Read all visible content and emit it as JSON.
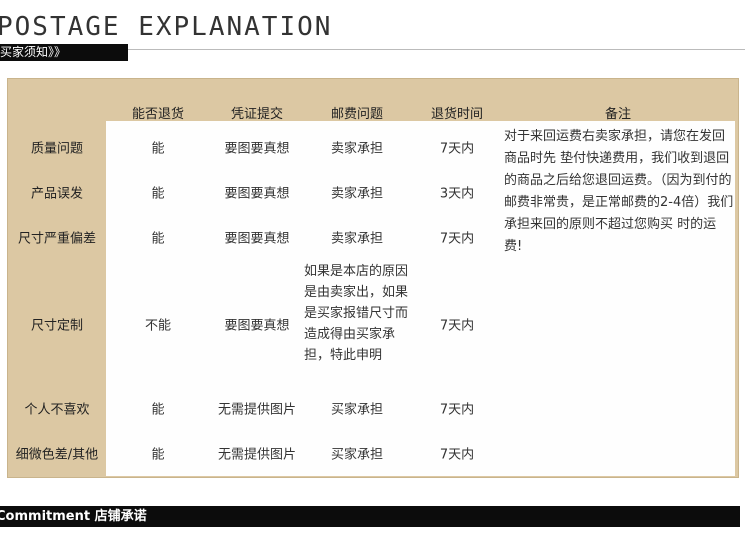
{
  "header": {
    "title": "POSTAGE EXPLANATION",
    "subtitle": "买家须知》》"
  },
  "table": {
    "columns": [
      "能否退货",
      "凭证提交",
      "邮费问题",
      "退货时间",
      "备注"
    ],
    "rows": [
      {
        "label": "质量问题",
        "can_return": "能",
        "proof": "要图要真想",
        "postage": "卖家承担",
        "time": "7天内"
      },
      {
        "label": "产品误发",
        "can_return": "能",
        "proof": "要图要真想",
        "postage": "卖家承担",
        "time": "3天内"
      },
      {
        "label": "尺寸严重偏差",
        "can_return": "能",
        "proof": "要图要真想",
        "postage": "卖家承担",
        "time": "7天内"
      },
      {
        "label": "尺寸定制",
        "can_return": "不能",
        "proof": "要图要真想",
        "postage": "如果是本店的原因是由卖家出，如果是买家报错尺寸而造成得由买家承担，特此申明",
        "time": "7天内"
      },
      {
        "label": "个人不喜欢",
        "can_return": "能",
        "proof": "无需提供图片",
        "postage": "买家承担",
        "time": "7天内"
      },
      {
        "label": "细微色差/其他",
        "can_return": "能",
        "proof": "无需提供图片",
        "postage": "买家承担",
        "time": "7天内"
      }
    ],
    "note": "对于来回运费右卖家承担，请您在发回商品时先 垫付快递费用，我们收到退回的商品之后给您退回运费。（因为到付的邮费非常贵，是正常邮费的2-4倍）我们承担来回的原则不超过您购买 时的运费!"
  },
  "footer": {
    "label": "Commitment 店铺承诺"
  }
}
